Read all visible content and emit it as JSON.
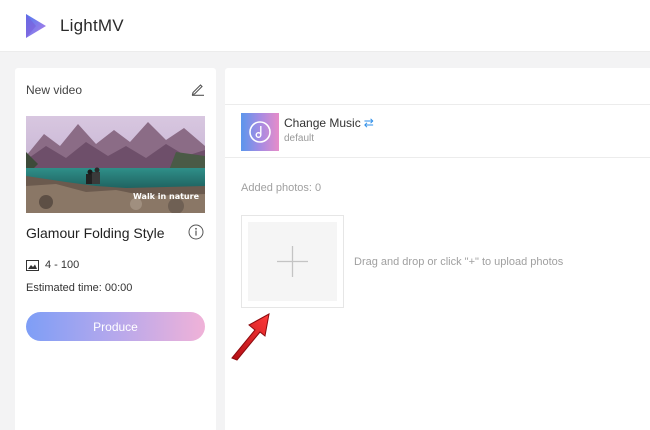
{
  "header": {
    "app_title": "LightMV",
    "logo_icon": "lightmv-logo-icon"
  },
  "project": {
    "label": "New video",
    "edit_icon": "pencil-icon",
    "thumbnail_caption": "Walk in nature",
    "template_name": "Glamour Folding Style",
    "info_icon": "info-icon",
    "photo_range": "4 - 100",
    "photo_icon": "image-icon",
    "estimated_time": "Estimated time: 00:00",
    "produce_label": "Produce"
  },
  "music": {
    "title": "Change Music",
    "swap_icon": "⇄",
    "subtitle": "default",
    "cover_icon": "music-note-icon"
  },
  "photos": {
    "added_label": "Added photos: 0",
    "upload_hint": "Drag and drop or click \"+\" to upload photos",
    "plus_icon": "plus-icon"
  },
  "colors": {
    "produce_gradient": [
      "#7e9ef6",
      "#f0b2d8"
    ],
    "music_gradient": [
      "#5b96ec",
      "#e78cc9"
    ],
    "accent_blue": "#2f8fe8",
    "arrow_red": "#d9171d"
  }
}
